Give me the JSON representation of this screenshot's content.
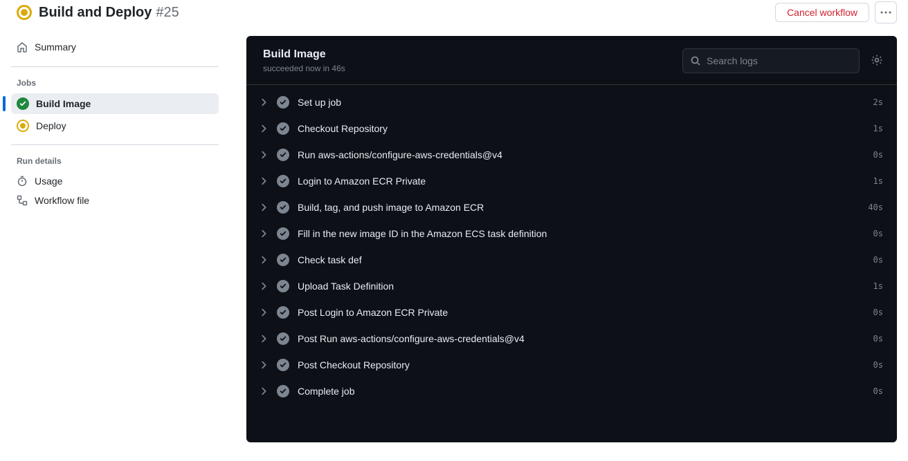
{
  "header": {
    "workflow_name": "Build and Deploy",
    "run_number": "#25",
    "cancel_label": "Cancel workflow"
  },
  "sidebar": {
    "summary_label": "Summary",
    "jobs_heading": "Jobs",
    "jobs": [
      {
        "label": "Build Image",
        "status": "success",
        "active": true
      },
      {
        "label": "Deploy",
        "status": "running",
        "active": false
      }
    ],
    "run_details_heading": "Run details",
    "run_details": [
      {
        "label": "Usage",
        "icon": "stopwatch-icon"
      },
      {
        "label": "Workflow file",
        "icon": "workflow-icon"
      }
    ]
  },
  "main": {
    "job_title": "Build Image",
    "job_status_line": "succeeded now in 46s",
    "search_placeholder": "Search logs",
    "steps": [
      {
        "name": "Set up job",
        "duration": "2s"
      },
      {
        "name": "Checkout Repository",
        "duration": "1s"
      },
      {
        "name": "Run aws-actions/configure-aws-credentials@v4",
        "duration": "0s"
      },
      {
        "name": "Login to Amazon ECR Private",
        "duration": "1s"
      },
      {
        "name": "Build, tag, and push image to Amazon ECR",
        "duration": "40s"
      },
      {
        "name": "Fill in the new image ID in the Amazon ECS task definition",
        "duration": "0s"
      },
      {
        "name": "Check task def",
        "duration": "0s"
      },
      {
        "name": "Upload Task Definition",
        "duration": "1s"
      },
      {
        "name": "Post Login to Amazon ECR Private",
        "duration": "0s"
      },
      {
        "name": "Post Run aws-actions/configure-aws-credentials@v4",
        "duration": "0s"
      },
      {
        "name": "Post Checkout Repository",
        "duration": "0s"
      },
      {
        "name": "Complete job",
        "duration": "0s"
      }
    ]
  }
}
